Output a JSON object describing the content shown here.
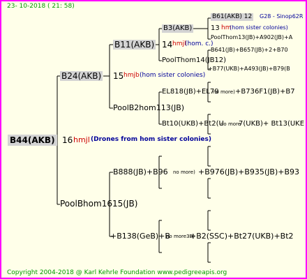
{
  "header": {
    "date": "23- 10-2018 ( 21: 58)"
  },
  "footer": {
    "copyright": "Copyright 2004-2018 @ Karl Kehrle Foundation   www.pedigreeapis.org"
  },
  "root": {
    "id": "B44(AKB)",
    "gen_num": "16",
    "breeder": "hmjl",
    "note": "(Drones from hom sister colonies)"
  },
  "gen1": {
    "top": "B24(AKB)",
    "bottom": "PoolBhom1615(JB)",
    "top_num": "15",
    "top_breeder": "hmjb",
    "top_note": "(hom sister colonies)"
  },
  "gen2": {
    "b11": "B11(AKB)",
    "b11_num": "14",
    "b11_breeder": "hmjl",
    "b11_note": "(hom. c.)",
    "poolb2": "PoolB2hom113(JB)",
    "b888": "B888(JB)+B96",
    "b888_mid": "no more)",
    "b888_rest": "+B976(JB)+B935(JB)+B93",
    "b138": "+B138(GeB)+B",
    "b138_mid": "no more3B)",
    "b138_rest": "+B2(SSC)+Bt27(UKB)+Bt2"
  },
  "gen3": {
    "b3": "B3(AKB)",
    "b3_num": "13",
    "b3_breeder": "hm",
    "b3_note": "(hom sister colonies)",
    "poolthom14": "PoolThom14(JB12)",
    "el818": "EL818(JB)+EL79",
    "el818_mid": "no more)",
    "el818_rest": "+B736F1(JB)+B7",
    "bt10": "Bt10(UKB)+Bt2(U",
    "bt10_mid": "no more",
    "bt10_rest": "7(UKB)+ Bt13(UKE"
  },
  "gen4": {
    "b61": "B61(AKB) 12",
    "b61_tag": "G28 - Sinop62R",
    "poolthom13": "PoolThom13(JB)+A902(JB)+A",
    "b641": "B641(JB)+B657(JB)+2+B70",
    "b77": "+B77(UKB)+A493(JB)+B79(B"
  }
}
